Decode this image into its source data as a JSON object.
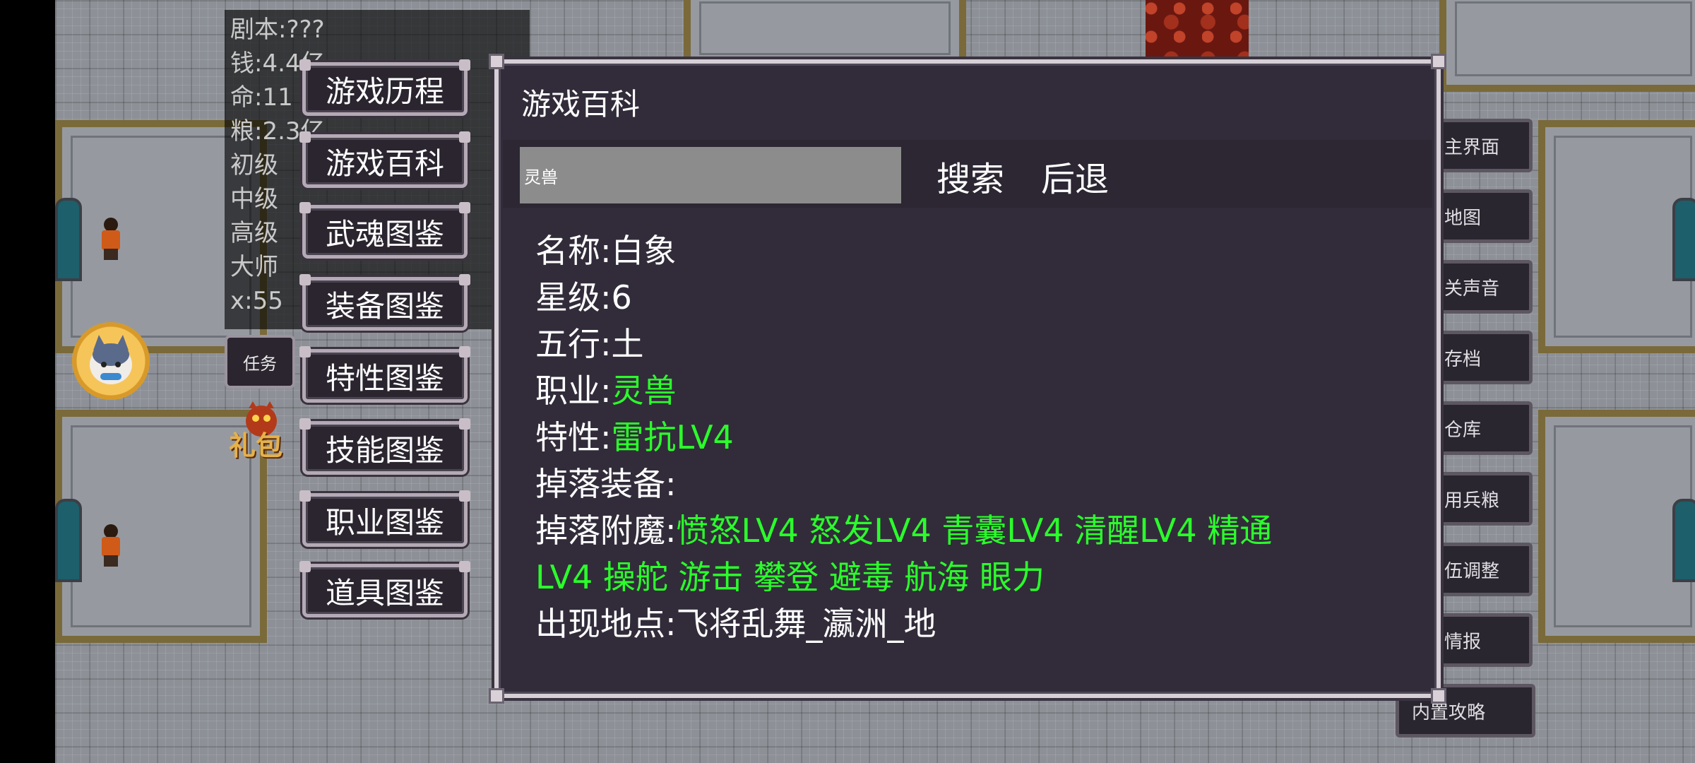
{
  "stats": {
    "lines": [
      "剧本:???",
      "钱:4.4亿",
      "命:11",
      "粮:2.3亿",
      "初级",
      "中级",
      "高级",
      "大师",
      "x:55"
    ]
  },
  "left_menu": {
    "items": [
      "游戏历程",
      "游戏百科",
      "武魂图鉴",
      "装备图鉴",
      "特性图鉴",
      "技能图鉴",
      "职业图鉴",
      "道具图鉴"
    ]
  },
  "task_label": "任务",
  "gift_label": "礼包",
  "right_menu": {
    "items": [
      "主界面",
      "地图",
      "关声音",
      "存档",
      "仓库",
      "用兵粮",
      "伍调整",
      "情报",
      "内置攻略"
    ]
  },
  "dialog": {
    "title": "游戏百科",
    "search_value": "灵兽",
    "search_button": "搜索",
    "back_button": "后退",
    "fields": {
      "name_label": "名称:",
      "name_value": "白象",
      "star_label": "星级:",
      "star_value": "6",
      "element_label": "五行:",
      "element_value": "土",
      "class_label": "职业:",
      "class_value": "灵兽",
      "trait_label": "特性:",
      "trait_value": "雷抗LV4",
      "drop_equip_label": "掉落装备:",
      "drop_enchant_label": "掉落附魔:",
      "drop_enchant_value_1": "愤怒LV4 怒发LV4 青囊LV4 清醒LV4 精通",
      "drop_enchant_value_2": "LV4 操舵 游击 攀登 避毒 航海 眼力",
      "location_label": "出现地点:",
      "location_value": "飞将乱舞_瀛洲_地"
    }
  },
  "colors": {
    "dialog_bg": "#322c3a",
    "highlight_green": "#2bff2b",
    "search_bg": "#8c8c8c"
  }
}
